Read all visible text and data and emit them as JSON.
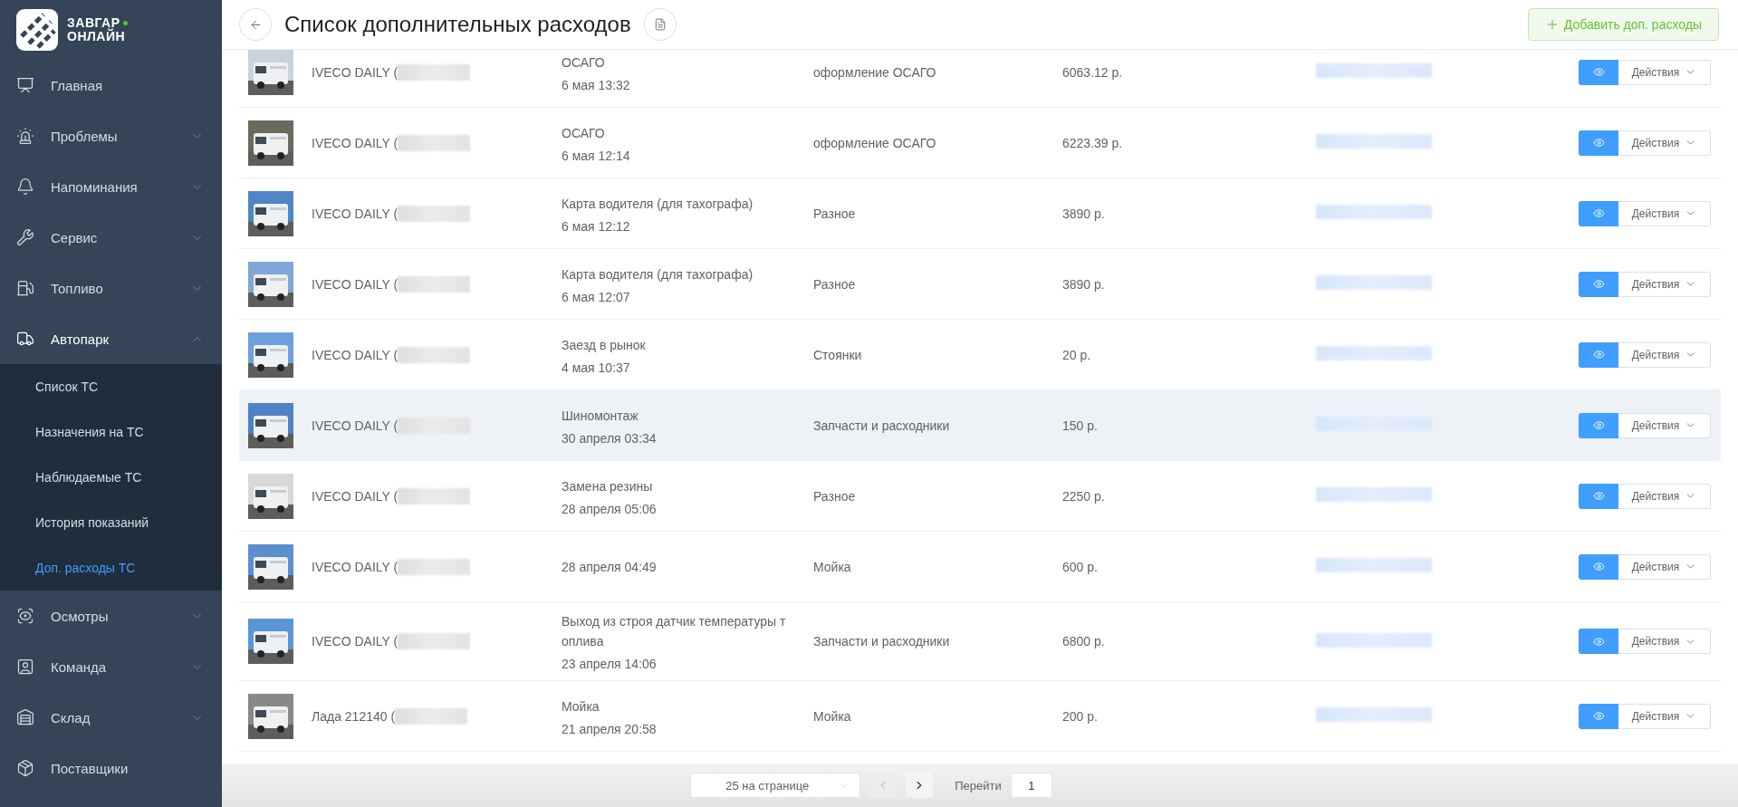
{
  "logo": {
    "line1": "ЗАВГАР",
    "line2": "ОНЛАЙН"
  },
  "sidebar": {
    "items": [
      {
        "label": "Главная"
      },
      {
        "label": "Проблемы",
        "expanded": false
      },
      {
        "label": "Напоминания",
        "expanded": false
      },
      {
        "label": "Сервис",
        "expanded": false
      },
      {
        "label": "Топливо",
        "expanded": false
      },
      {
        "label": "Автопарк",
        "expanded": true,
        "children": [
          {
            "label": "Список ТС",
            "selected": false
          },
          {
            "label": "Назначения на ТС",
            "selected": false
          },
          {
            "label": "Наблюдаемые ТС",
            "selected": false
          },
          {
            "label": "История показаний",
            "selected": false
          },
          {
            "label": "Доп. расходы ТС",
            "selected": true
          }
        ]
      },
      {
        "label": "Осмотры",
        "expanded": false
      },
      {
        "label": "Команда",
        "expanded": false
      },
      {
        "label": "Склад",
        "expanded": false
      },
      {
        "label": "Поставщики"
      }
    ]
  },
  "header": {
    "title": "Список дополнительных расходов",
    "add_button": "Добавить доп. расходы"
  },
  "table": {
    "rows": [
      {
        "vehicle": "IVECO DAILY (",
        "title": "ОСАГО",
        "date": "6 мая 13:32",
        "category": "оформление ОСАГО",
        "amount": "6063.12 р.",
        "view": "Действия",
        "selected": false
      },
      {
        "vehicle": "IVECO DAILY (",
        "title": "ОСАГО",
        "date": "6 мая 12:14",
        "category": "оформление ОСАГО",
        "amount": "6223.39 р.",
        "view": "Действия",
        "selected": false
      },
      {
        "vehicle": "IVECO DAILY (",
        "title": "Карта водителя (для тахографа)",
        "date": "6 мая 12:12",
        "category": "Разное",
        "amount": "3890 р.",
        "view": "Действия",
        "selected": false
      },
      {
        "vehicle": "IVECO DAILY (",
        "title": "Карта водителя (для тахографа)",
        "date": "6 мая 12:07",
        "category": "Разное",
        "amount": "3890 р.",
        "view": "Действия",
        "selected": false
      },
      {
        "vehicle": "IVECO DAILY (",
        "title": "Заезд в рынок",
        "date": "4 мая 10:37",
        "category": "Стоянки",
        "amount": "20 р.",
        "view": "Действия",
        "selected": false
      },
      {
        "vehicle": "IVECO DAILY (",
        "title": "Шиномонтаж",
        "date": "30 апреля 03:34",
        "category": "Запчасти и расходники",
        "amount": "150 р.",
        "view": "Действия",
        "selected": true
      },
      {
        "vehicle": "IVECO DAILY (",
        "title": "Замена резины",
        "date": "28 апреля 05:06",
        "category": "Разное",
        "amount": "2250 р.",
        "view": "Действия",
        "selected": false
      },
      {
        "vehicle": "IVECO DAILY (",
        "date": "28 апреля 04:49",
        "category": "Мойка",
        "amount": "600 р.",
        "view": "Действия",
        "selected": false
      },
      {
        "vehicle": "IVECO DAILY (",
        "title": "Выход из строя датчик температуры топлива",
        "date": "23 апреля 14:06",
        "category": "Запчасти и расходники",
        "amount": "6800 р.",
        "view": "Действия",
        "selected": false
      },
      {
        "vehicle": "Лада 212140 (",
        "title": "Мойка",
        "date": "21 апреля 20:58",
        "category": "Мойка",
        "amount": "200 р.",
        "view": "Действия",
        "selected": false
      }
    ]
  },
  "pagination": {
    "page_size": "25 на странице",
    "prev_disabled": true,
    "next_disabled": false,
    "goto_label": "Перейти",
    "goto_value": "1"
  }
}
